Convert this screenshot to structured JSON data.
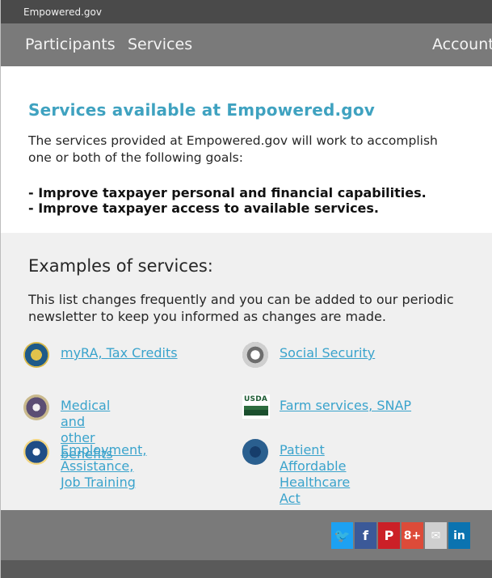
{
  "site": {
    "title": "Empowered.gov"
  },
  "nav": {
    "participants": "Participants",
    "services": "Services",
    "account": "Account"
  },
  "intro": {
    "title": "Services available at Empowered.gov",
    "text": "The services provided at Empowered.gov will work to accomplish one or both of the following goals:",
    "goal_1": "- Improve taxpayer personal and financial capabilities.",
    "goal_2": "- Improve taxpayer access to available services."
  },
  "examples": {
    "title": "Examples of services:",
    "text": "This list changes frequently and you can be added to our periodic newsletter to keep you informed as changes are made.",
    "items": [
      {
        "label": "myRA, Tax Credits",
        "icon": "treasury-seal-icon"
      },
      {
        "label": "Social Security",
        "icon": "ssa-seal-icon"
      },
      {
        "label": "Medical and\nother benefits",
        "icon": "va-seal-icon"
      },
      {
        "label": "Farm services, SNAP",
        "icon": "usda-logo-icon"
      },
      {
        "label": "Employment,\nAssistance,\nJob Training",
        "icon": "dol-seal-icon"
      },
      {
        "label": "Patient Affordable\nHealthcare Act",
        "icon": "hhs-seal-icon"
      }
    ]
  },
  "usda": {
    "logo_text": "USDA"
  },
  "social": {
    "twitter": "🐦",
    "facebook": "f",
    "pinterest": "P",
    "gplus": "8+",
    "email": "✉",
    "linkedin": "in"
  },
  "colors": {
    "accent": "#3fa2c0",
    "link": "#3aa3cc",
    "topbar": "#4a4a4a",
    "navbar": "#7a7a7a",
    "examples_bg": "#f0f0f0"
  }
}
